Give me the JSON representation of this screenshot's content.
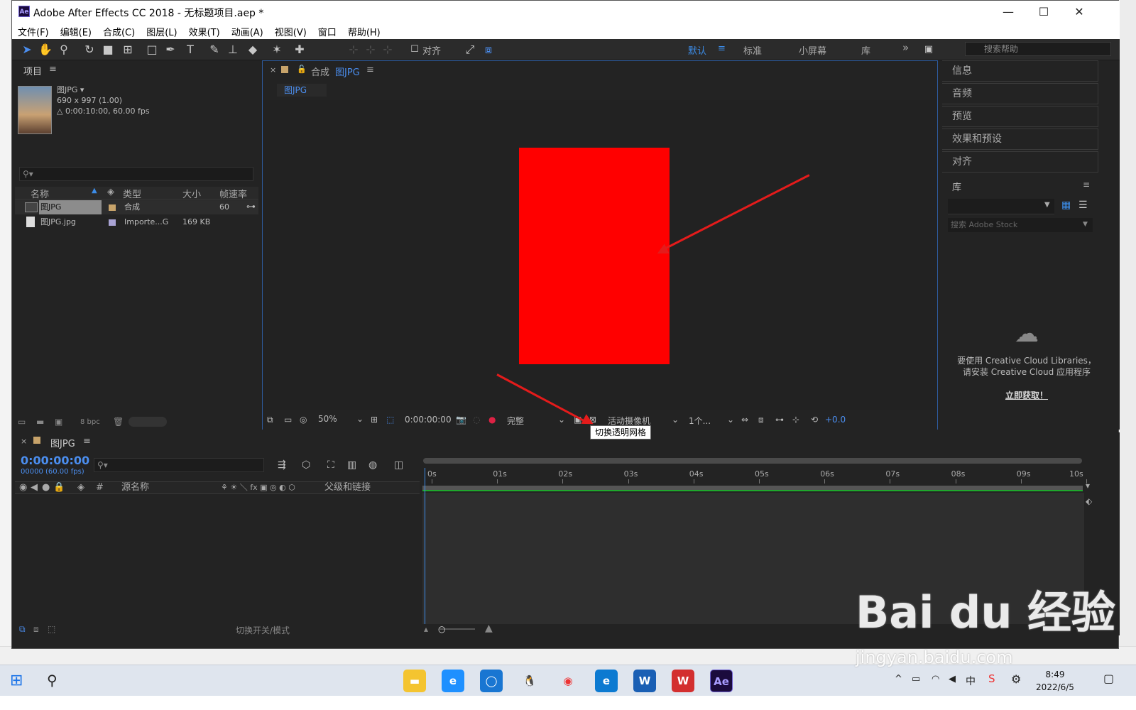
{
  "window": {
    "title": "Adobe After Effects CC 2018 - 无标题项目.aep *",
    "logo": "Ae",
    "minimize": "—",
    "maximize": "☐",
    "close": "✕"
  },
  "menu": [
    "文件(F)",
    "编辑(E)",
    "合成(C)",
    "图层(L)",
    "效果(T)",
    "动画(A)",
    "视图(V)",
    "窗口",
    "帮助(H)"
  ],
  "toolbar": {
    "snap_label": "对齐",
    "workspaces": [
      "默认",
      "标准",
      "小屏幕",
      "库"
    ],
    "more": "»",
    "help_placeholder": "搜索帮助"
  },
  "project": {
    "title": "项目",
    "item_name": "图JPG",
    "item_dims": "690 x 997 (1.00)",
    "item_dur": "△ 0:00:10:00, 60.00 fps",
    "columns": [
      "名称",
      "类型",
      "大小",
      "帧速率"
    ],
    "rows": [
      {
        "name": "图JPG",
        "type": "合成",
        "size": "",
        "fps": "60"
      },
      {
        "name": "图JPG.jpg",
        "type": "Importe...G",
        "size": "169 KB",
        "fps": ""
      }
    ],
    "bpc": "8 bpc"
  },
  "comp": {
    "tab_prefix": "合成",
    "tab_name": "图JPG",
    "subtab": "图JPG",
    "zoom": "50%",
    "time": "0:00:00:00",
    "quality": "完整",
    "camera": "活动摄像机",
    "views": "1个...",
    "exposure": "+0.0",
    "tooltip": "切换透明网格"
  },
  "right_panel": {
    "sections": [
      "信息",
      "音频",
      "预览",
      "效果和预设",
      "对齐"
    ],
    "library_title": "库",
    "stock_placeholder": "搜索 Adobe Stock",
    "cloud_msg_1": "要使用 Creative Cloud Libraries，",
    "cloud_msg_2": "请安装 Creative Cloud 应用程序",
    "get_link": "立即获取！"
  },
  "timeline": {
    "tab": "图JPG",
    "timecode": "0:00:00:00",
    "frames": "00000 (60.00 fps)",
    "col_hash": "#",
    "col_source": "源名称",
    "col_parent": "父级和链接",
    "ticks": [
      "0s",
      "01s",
      "02s",
      "03s",
      "04s",
      "05s",
      "06s",
      "07s",
      "08s",
      "09s",
      "10s"
    ],
    "footer_toggle": "切换开关/模式"
  },
  "taskbar": {
    "time": "8:49",
    "date": "2022/6/5",
    "ime": "中"
  },
  "watermark": {
    "brand": "Bai du 经验",
    "url": "jingyan.baidu.com"
  },
  "colors": {
    "accent": "#3c8ce7",
    "solid": "#ff0000",
    "arrow": "#e41b1b",
    "panel": "#232323"
  }
}
